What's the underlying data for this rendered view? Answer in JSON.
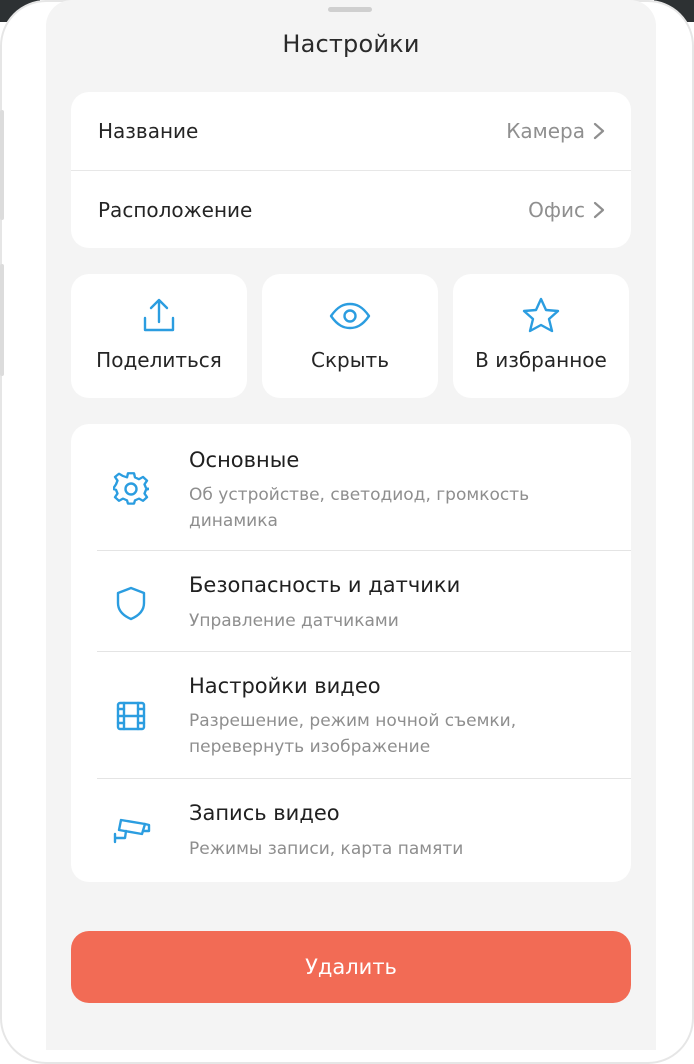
{
  "header": {
    "title": "Настройки"
  },
  "properties": [
    {
      "label": "Название",
      "value": "Камера"
    },
    {
      "label": "Расположение",
      "value": "Офис"
    }
  ],
  "actions": [
    {
      "label": "Поделиться",
      "icon": "share-icon"
    },
    {
      "label": "Скрыть",
      "icon": "eye-icon"
    },
    {
      "label": "В избранное",
      "icon": "star-icon"
    }
  ],
  "menu": [
    {
      "title": "Основные",
      "subtitle_1": "Об устройстве, светодиод, громкость",
      "subtitle_2": "динамика",
      "icon": "gear-icon"
    },
    {
      "title": "Безопасность и датчики",
      "subtitle_1": "Управление датчиками",
      "icon": "shield-icon"
    },
    {
      "title": "Настройки видео",
      "subtitle_1": "Разрешение, режим ночной съемки,",
      "subtitle_2": "перевернуть изображение",
      "icon": "film-icon"
    },
    {
      "title": "Запись видео",
      "subtitle_1": "Режимы записи, карта памяти",
      "icon": "security-camera-icon"
    }
  ],
  "footer": {
    "delete_label": "Удалить"
  },
  "colors": {
    "accent": "#2b9de0",
    "danger": "#f26b55",
    "sheet_bg": "#f4f4f4"
  }
}
